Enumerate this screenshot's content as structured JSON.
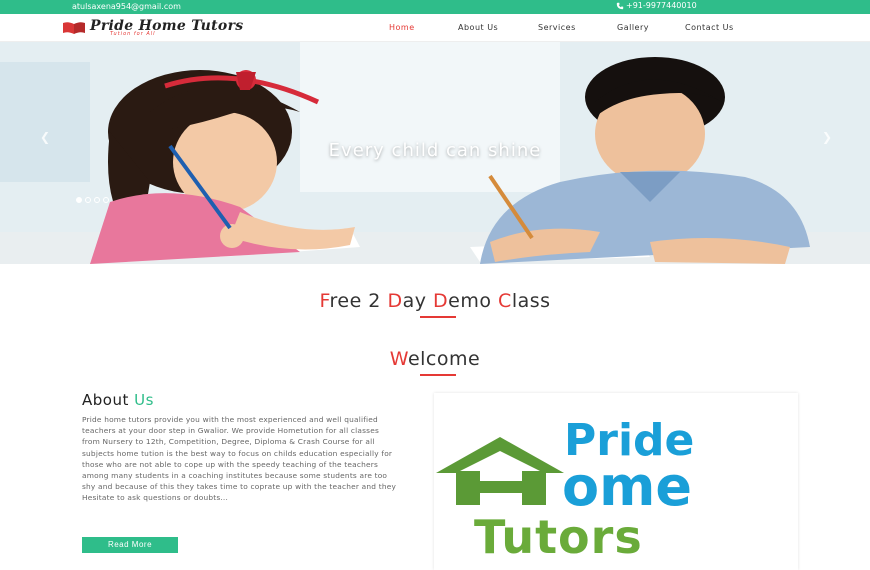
{
  "topbar": {
    "email": "atulsaxena954@gmail.com",
    "phone": "+91-9977440010"
  },
  "header": {
    "logo_text": "Pride Home Tutors",
    "logo_tagline": "Tution for All",
    "nav": [
      {
        "label": "Home",
        "active": true
      },
      {
        "label": "About Us",
        "active": false
      },
      {
        "label": "Services",
        "active": false
      },
      {
        "label": "Gallery",
        "active": false
      },
      {
        "label": "Contact Us",
        "active": false
      }
    ]
  },
  "hero": {
    "caption": "Every child can shine",
    "prev_icon": "chevron-left-icon",
    "next_icon": "chevron-right-icon",
    "slide_count": 4,
    "active_slide": 1
  },
  "demo": {
    "parts": [
      "F",
      "ree 2 ",
      "D",
      "ay ",
      "D",
      "emo ",
      "C",
      "lass"
    ]
  },
  "welcome": {
    "first": "W",
    "rest": "elcome"
  },
  "about": {
    "title_a": "About ",
    "title_b": "Us",
    "text": "Pride home tutors provide you with the most experienced and well qualified teachers at your door step in Gwalior. We provide Hometution for all classes from Nursery to 12th, Competition, Degree, Diploma & Crash Course for all subjects home tution is the best way to focus on childs education especially for those who are not able to cope up with the speedy teaching of the teachers among many students in a coaching institutes because some students are too shy and because of this they takes time to coprate up with the teacher and they Hesitate to ask questions or doubts...",
    "button": "Read More"
  },
  "brand_image": {
    "line1": "Pride",
    "line2": "ome",
    "line3": "Tutors"
  },
  "colors": {
    "accent": "#2fbd8a",
    "red": "#e53935",
    "brand_blue": "#1a9fd8",
    "brand_green": "#6aab3a"
  }
}
